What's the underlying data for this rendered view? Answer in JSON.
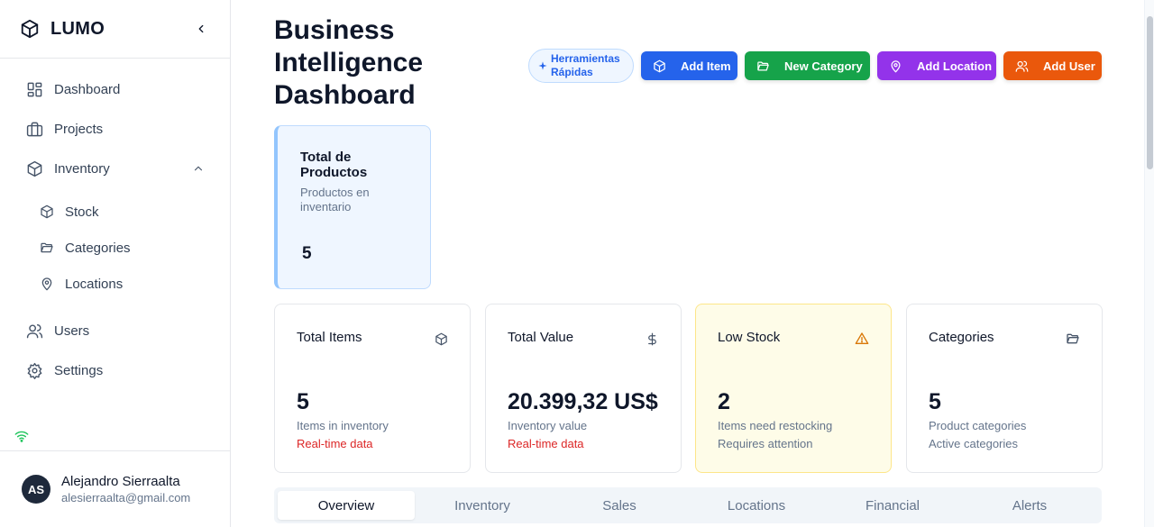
{
  "sidebar": {
    "brand": "LUMO",
    "brand_icon": "box-icon",
    "collapse_icon": "chevron-left-icon",
    "items": [
      {
        "label": "Dashboard",
        "icon": "layout-dashboard-icon"
      },
      {
        "label": "Projects",
        "icon": "briefcase-icon"
      },
      {
        "label": "Inventory",
        "icon": "package-icon",
        "expanded": true
      },
      {
        "label": "Users",
        "icon": "users-icon"
      },
      {
        "label": "Settings",
        "icon": "settings-icon"
      }
    ],
    "subitems": [
      {
        "label": "Stock",
        "icon": "package-icon"
      },
      {
        "label": "Categories",
        "icon": "folder-open-icon"
      },
      {
        "label": "Locations",
        "icon": "map-pin-icon"
      }
    ],
    "status_icon": "wifi-icon",
    "status_color": "#22c55e",
    "user": {
      "initials": "AS",
      "name": "Alejandro Sierraalta",
      "email": "alesierraalta@gmail.com"
    }
  },
  "header": {
    "title": "Business Intelligence Dashboard",
    "quick_tools": "Herramientas Rápidas",
    "actions": [
      {
        "label": "Add Item",
        "icon": "package-icon",
        "color": "#2563eb"
      },
      {
        "label": "New Category",
        "icon": "folder-open-icon",
        "color": "#16a34a"
      },
      {
        "label": "Add Location",
        "icon": "map-pin-icon",
        "color": "#9333ea"
      },
      {
        "label": "Add User",
        "icon": "users-icon",
        "color": "#ea580c"
      }
    ]
  },
  "products_card": {
    "title": "Total de Productos",
    "subtitle": "Productos en inventario",
    "value": "5"
  },
  "stats": [
    {
      "title": "Total Items",
      "icon": "package-icon",
      "value": "5",
      "sub1": "Items in inventory",
      "sub2": "Real-time data"
    },
    {
      "title": "Total Value",
      "icon": "dollar-sign-icon",
      "value": "20.399,32 US$",
      "sub1": "Inventory value",
      "sub2": "Real-time data"
    },
    {
      "title": "Low Stock",
      "icon": "alert-triangle-icon",
      "value": "2",
      "sub1": "Items need restocking",
      "sub2": "Requires attention"
    },
    {
      "title": "Categories",
      "icon": "folder-open-icon",
      "value": "5",
      "sub1": "Product categories",
      "sub2": "Active categories"
    }
  ],
  "tabs": {
    "items": [
      "Overview",
      "Inventory",
      "Sales",
      "Locations",
      "Financial",
      "Alerts"
    ],
    "active": "Overview"
  },
  "colors": {
    "accent": "#2563eb",
    "alert": "#dc2626",
    "warning": "#d97706"
  }
}
